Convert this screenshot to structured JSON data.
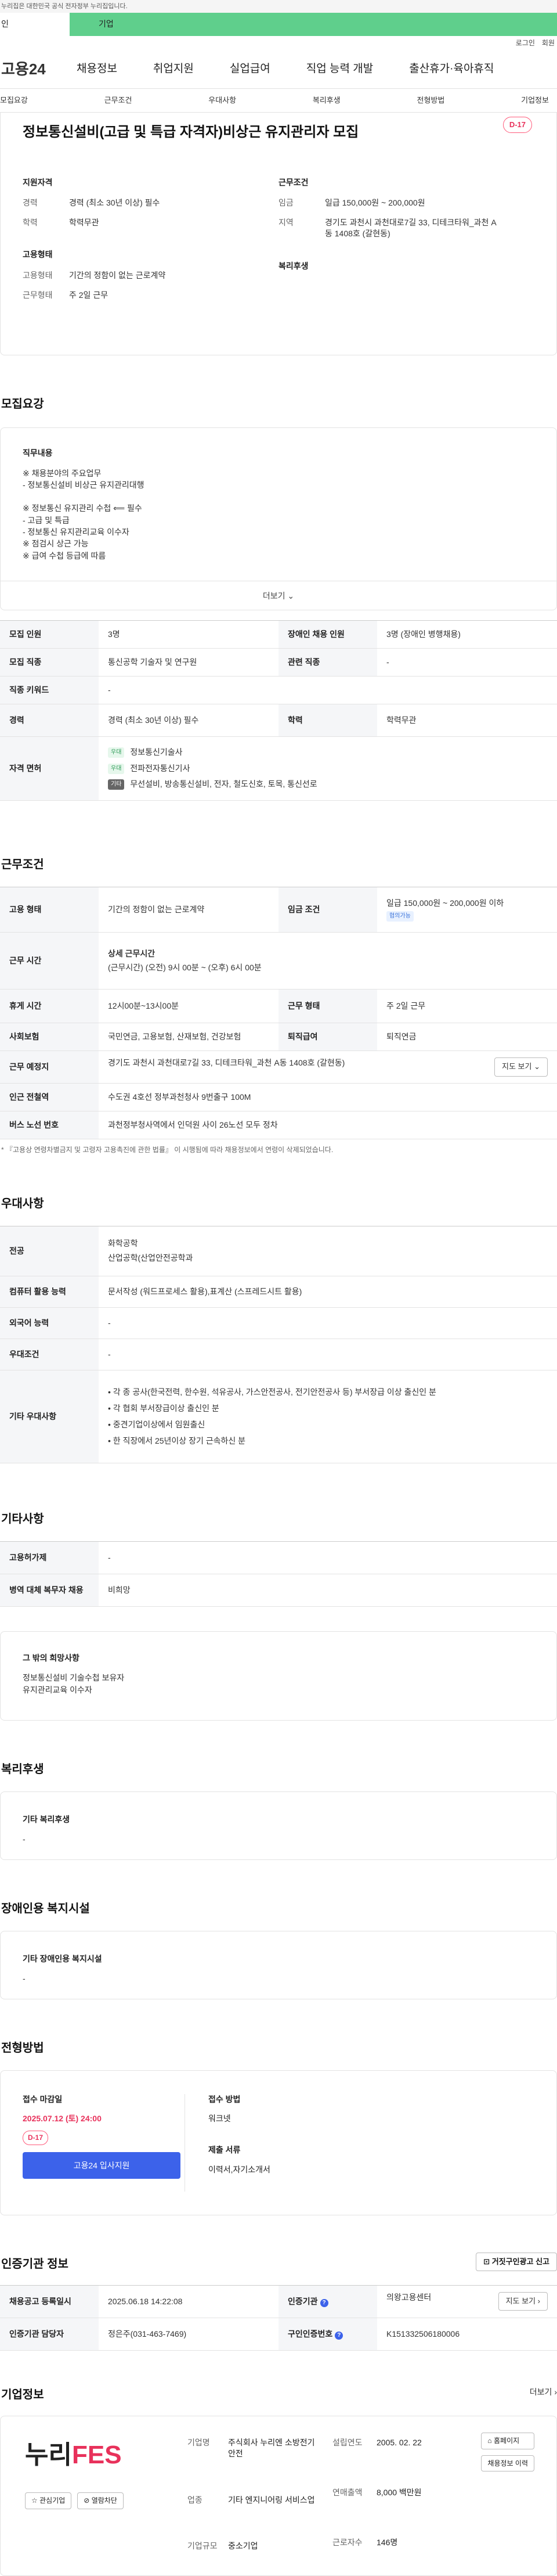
{
  "topbar": {
    "text": "누리집은 대한민국 공식 전자정부 누리집입니다."
  },
  "tabs": [
    "인",
    "기업"
  ],
  "util": [
    "로그인",
    "회원"
  ],
  "gnb": {
    "logo": "고용24",
    "items": [
      "채용정보",
      "취업지원",
      "실업급여",
      "직업 능력 개발",
      "출산휴가·육아휴직"
    ]
  },
  "anchors": [
    "모집요강",
    "근무조건",
    "우대사항",
    "복리후생",
    "전형방법",
    "기업정보"
  ],
  "job": {
    "title": "정보통신설비(고급 및 특급 자격자)비상근 유지관리자 모집",
    "dday": "D-17",
    "left": {
      "title1": "지원자격",
      "rows1": [
        {
          "k": "경력",
          "v": "경력 (최소 30년 이상) 필수"
        },
        {
          "k": "학력",
          "v": "학력무관"
        }
      ],
      "title2": "고용형태",
      "rows2": [
        {
          "k": "고용형태",
          "v": "기간의 정함이 없는 근로계약"
        },
        {
          "k": "근무형태",
          "v": "주 2일 근무"
        }
      ]
    },
    "right": {
      "title1": "근무조건",
      "rows1": [
        {
          "k": "임금",
          "v": "일급 150,000원 ~ 200,000원"
        },
        {
          "k": "지역",
          "v": "경기도 과천시 과천대로7길 33, 디테크타워_과천 A동 1408호 (갈현동)"
        }
      ],
      "title2": "복리후생"
    }
  },
  "recruit": {
    "section": "모집요강",
    "duty_title": "직무내용",
    "duty_text": "※ 채용분야의 주요업무\n - 정보통신설비 비상근 유지관리대행\n\n※ 정보통신 유지관리 수첩 ⟸ 필수\n - 고급 및 특급\n - 정보통신 유지관리교육 이수자\n※ 점검시 상근 가능\n※ 급여 수첩 등급에 따름",
    "more": "더보기",
    "rows": {
      "count_k": "모집 인원",
      "count_v": "3명",
      "dis_k": "장애인 채용 인원",
      "dis_v": "3명 (장애인 병행채용)",
      "job_k": "모집 직종",
      "job_v": "통신공학 기술자 및 연구원",
      "rel_k": "관련 직종",
      "rel_v": "-",
      "kw_k": "직종 키워드",
      "kw_v": "-",
      "car_k": "경력",
      "car_v": "경력 (최소 30년 이상) 필수",
      "edu_k": "학력",
      "edu_v": "학력무관",
      "lic_k": "자격 면허",
      "lic": [
        {
          "tag": "우대",
          "v": "정보통신기술사"
        },
        {
          "tag": "우대",
          "v": "전파전자통신기사"
        },
        {
          "tag": "기타",
          "v": "무선설비, 방송통신설비, 전자, 철도신호, 토목, 통신선로"
        }
      ]
    }
  },
  "work": {
    "section": "근무조건",
    "rows": {
      "type_k": "고용 형태",
      "type_v": "기간의 정함이 없는 근로계약",
      "wage_k": "임금 조건",
      "wage_v": "일급 150,000원 ~ 200,000원 이하",
      "wage_tag": "협의가능",
      "time_k": "근무 시간",
      "time_t": "상세 근무시간",
      "time_v": "(근무시간) (오전) 9시 00분 ~ (오후) 6시 00분",
      "rest_k": "휴게 시간",
      "rest_v": "12시00분~13시00분",
      "form_k": "근무 형태",
      "form_v": "주 2일 근무",
      "ins_k": "사회보험",
      "ins_v": "국민연금, 고용보험, 산재보험, 건강보험",
      "ret_k": "퇴직급여",
      "ret_v": "퇴직연금",
      "loc_k": "근무 예정지",
      "loc_v": "경기도 과천시 과천대로7길 33, 디테크타워_과천 A동 1408호 (갈현동)",
      "map": "지도 보기",
      "sub_k": "인근 전철역",
      "sub_v": "수도권 4호선 정부과천청사 9번출구 100M",
      "bus_k": "버스 노선 번호",
      "bus_v": "과천정부청사역에서 인덕원 사이 26노선 모두 정차"
    },
    "note": "* 『고용상 연령차별금지 및 고령자 고용촉진에 관한 법률』 이 시행됨에 따라 채용정보에서 연령이 삭제되었습니다."
  },
  "pref": {
    "section": "우대사항",
    "major_k": "전공",
    "major_v1": "화학공학",
    "major_v2": "산업공학(산업안전공학과",
    "pc_k": "컴퓨터 활용 능력",
    "pc_v": "문서작성 (워드프로세스 활용),표계산 (스프레드시트 활용)",
    "lang_k": "외국어 능력",
    "lang_v": "-",
    "cond_k": "우대조건",
    "cond_v": "-",
    "etc_k": "기타 우대사항",
    "etc_v": "• 각 종 공사(한국전력, 한수원, 석유공사, 가스안전공사, 전기안전공사 등) 부서장급 이상 출신인 분\n• 각 협회 부서장급이상 출신인 분\n• 중견기업이상에서 임원출신\n• 한 직장에서 25년이상 장기 근속하신 분"
  },
  "other": {
    "section": "기타사항",
    "hire_k": "고용허가제",
    "hire_v": "-",
    "mil_k": "병역 대체 복무자 채용",
    "mil_v": "비희망",
    "wish_t": "그 밖의 희망사항",
    "wish_v": "정보통신설비 기술수첩 보유자\n유지관리교육 이수자"
  },
  "welfare": {
    "section": "복리후생",
    "t": "기타 복리후생",
    "v": "-"
  },
  "disfac": {
    "section": "장애인용 복지시설",
    "t": "기타 장애인용 복지시설",
    "v": "-"
  },
  "apply": {
    "section": "전형방법",
    "dead_t": "접수 마감일",
    "dead_v": "2025.07.12 (토) 24:00",
    "dday": "D-17",
    "btn": "고용24 입사지원",
    "method_t": "접수 방법",
    "method_v": "워크넷",
    "doc_t": "제출 서류",
    "doc_v": "이력서,자기소개서"
  },
  "agency": {
    "section": "인증기관 정보",
    "report": "거짓구인광고 신고",
    "reg_k": "채용공고 등록일시",
    "reg_v": "2025.06.18 14:22:08",
    "org_k": "인증기관",
    "org_v": "의왕고용센터",
    "map": "지도 보기",
    "mgr_k": "인증기관 담당자",
    "mgr_v": "정은주(031-463-7469)",
    "no_k": "구인인증번호",
    "no_v": "K151332506180006"
  },
  "company": {
    "section": "기업정보",
    "more": "더보기",
    "logo_a": "누리",
    "logo_b": "FES",
    "fav": "관심기업",
    "block": "열람차단",
    "name_k": "기업명",
    "name_v": "주식회사 누리엔 소방전기안전",
    "ind_k": "업종",
    "ind_v": "기타 엔지니어링 서비스업",
    "scale_k": "기업규모",
    "scale_v": "중소기업",
    "est_k": "설립연도",
    "est_v": "2005. 02. 22",
    "sales_k": "연매출액",
    "sales_v": "8,000 백만원",
    "emp_k": "근로자수",
    "emp_v": "146명",
    "home": "홈페이지",
    "jobs": "채용정보 이력"
  }
}
